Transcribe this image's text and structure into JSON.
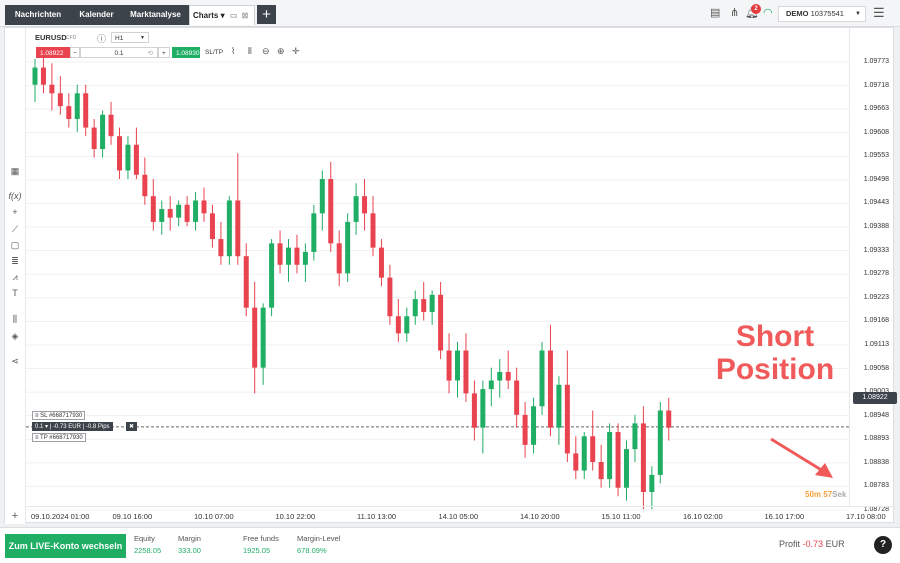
{
  "nav": {
    "tabs": [
      "Nachrichten",
      "Kalender",
      "Marktanalyse",
      "Charts ▾"
    ],
    "add_tab": "+",
    "notification_count": "2",
    "account_type": "DEMO",
    "account_number": "10375541"
  },
  "toolbar": {
    "symbol": "EURUSD",
    "symbol_suffix": "CFD",
    "timeframe": "H1",
    "sell_price": "1.08922",
    "quantity": "0.1",
    "buy_price": "1.08930",
    "sltp": "SL/TP"
  },
  "price_axis": [
    "1.09773",
    "1.09718",
    "1.09663",
    "1.09608",
    "1.09553",
    "1.09498",
    "1.09443",
    "1.09388",
    "1.09333",
    "1.09278",
    "1.09223",
    "1.09168",
    "1.09113",
    "1.09058",
    "1.09003",
    "1.08948",
    "1.08893",
    "1.08838",
    "1.08783",
    "1.08728"
  ],
  "current_price": "1.08922",
  "time_axis": [
    "09.10.2024 01:00",
    "09.10 16:00",
    "10.10 07:00",
    "10.10 22:00",
    "11.10 13:00",
    "14.10 05:00",
    "14.10 20:00",
    "15.10 11:00",
    "16.10 02:00",
    "16.10 17:00",
    "17.10 08:00"
  ],
  "position": {
    "sl_tag": "≡ SL",
    "sl_id": "#668717930",
    "qty": "0.1 ▾",
    "pl": "-0.73 EUR",
    "pips": "-0.8 Pips",
    "close": "✖",
    "tp_tag": "≡ TP",
    "tp_id": "#668717930"
  },
  "annotation": {
    "line1": "Short",
    "line2": "Position"
  },
  "timer": {
    "min": "50m",
    "sec": "57",
    "unit": "Sek"
  },
  "colors": {
    "up": "#1fae64",
    "down": "#e8434f",
    "annotation": "#f05a5a",
    "accent": "#1fae64"
  },
  "chart_data": {
    "type": "candlestick",
    "symbol": "EURUSD",
    "timeframe": "H1",
    "ylim": [
      1.087,
      1.098
    ],
    "candles": [
      [
        1.0972,
        1.0978,
        1.0968,
        1.0976
      ],
      [
        1.0976,
        1.098,
        1.097,
        1.0972
      ],
      [
        1.0972,
        1.0977,
        1.0966,
        1.097
      ],
      [
        1.097,
        1.0974,
        1.0965,
        1.0967
      ],
      [
        1.0967,
        1.097,
        1.0962,
        1.0964
      ],
      [
        1.0964,
        1.0972,
        1.0961,
        1.097
      ],
      [
        1.097,
        1.0972,
        1.096,
        1.0962
      ],
      [
        1.0962,
        1.0964,
        1.0955,
        1.0957
      ],
      [
        1.0957,
        1.0966,
        1.0955,
        1.0965
      ],
      [
        1.0965,
        1.0968,
        1.0958,
        1.096
      ],
      [
        1.096,
        1.0962,
        1.095,
        1.0952
      ],
      [
        1.0952,
        1.096,
        1.095,
        1.0958
      ],
      [
        1.0958,
        1.0962,
        1.095,
        1.0951
      ],
      [
        1.0951,
        1.0955,
        1.0944,
        1.0946
      ],
      [
        1.0946,
        1.095,
        1.0938,
        1.094
      ],
      [
        1.094,
        1.0945,
        1.0937,
        1.0943
      ],
      [
        1.0943,
        1.0946,
        1.0938,
        1.0941
      ],
      [
        1.0941,
        1.0945,
        1.0939,
        1.0944
      ],
      [
        1.0944,
        1.0946,
        1.0939,
        1.094
      ],
      [
        1.094,
        1.0947,
        1.0938,
        1.0945
      ],
      [
        1.0945,
        1.0948,
        1.094,
        1.0942
      ],
      [
        1.0942,
        1.0944,
        1.0934,
        1.0936
      ],
      [
        1.0936,
        1.094,
        1.093,
        1.0932
      ],
      [
        1.0932,
        1.0946,
        1.093,
        1.0945
      ],
      [
        1.0945,
        1.0956,
        1.093,
        1.0932
      ],
      [
        1.0932,
        1.0935,
        1.0918,
        1.092
      ],
      [
        1.092,
        1.0926,
        1.09,
        1.0906
      ],
      [
        1.0906,
        1.0921,
        1.0902,
        1.092
      ],
      [
        1.092,
        1.0936,
        1.0918,
        1.0935
      ],
      [
        1.0935,
        1.0938,
        1.0928,
        1.093
      ],
      [
        1.093,
        1.0936,
        1.0926,
        1.0934
      ],
      [
        1.0934,
        1.0937,
        1.0928,
        1.093
      ],
      [
        1.093,
        1.0935,
        1.0926,
        1.0933
      ],
      [
        1.0933,
        1.0944,
        1.0931,
        1.0942
      ],
      [
        1.0942,
        1.0952,
        1.0938,
        1.095
      ],
      [
        1.095,
        1.0954,
        1.0933,
        1.0935
      ],
      [
        1.0935,
        1.0938,
        1.0925,
        1.0928
      ],
      [
        1.0928,
        1.0942,
        1.0926,
        1.094
      ],
      [
        1.094,
        1.0949,
        1.0937,
        1.0946
      ],
      [
        1.0946,
        1.095,
        1.0938,
        1.0942
      ],
      [
        1.0942,
        1.0946,
        1.0932,
        1.0934
      ],
      [
        1.0934,
        1.0936,
        1.0925,
        1.0927
      ],
      [
        1.0927,
        1.093,
        1.0916,
        1.0918
      ],
      [
        1.0918,
        1.0922,
        1.0912,
        1.0914
      ],
      [
        1.0914,
        1.092,
        1.0912,
        1.0918
      ],
      [
        1.0918,
        1.0924,
        1.0916,
        1.0922
      ],
      [
        1.0922,
        1.0926,
        1.0917,
        1.0919
      ],
      [
        1.0919,
        1.0924,
        1.0916,
        1.0923
      ],
      [
        1.0923,
        1.0926,
        1.0908,
        1.091
      ],
      [
        1.091,
        1.0914,
        1.09,
        1.0903
      ],
      [
        1.0903,
        1.0912,
        1.0899,
        1.091
      ],
      [
        1.091,
        1.0914,
        1.0898,
        1.09
      ],
      [
        1.09,
        1.0903,
        1.0889,
        1.0892
      ],
      [
        1.0892,
        1.0903,
        1.0886,
        1.0901
      ],
      [
        1.0901,
        1.0906,
        1.0897,
        1.0903
      ],
      [
        1.0903,
        1.0908,
        1.0899,
        1.0905
      ],
      [
        1.0905,
        1.091,
        1.0901,
        1.0903
      ],
      [
        1.0903,
        1.0906,
        1.0892,
        1.0895
      ],
      [
        1.0895,
        1.0898,
        1.0885,
        1.0888
      ],
      [
        1.0888,
        1.0899,
        1.0886,
        1.0897
      ],
      [
        1.0897,
        1.0912,
        1.0895,
        1.091
      ],
      [
        1.091,
        1.0916,
        1.089,
        1.0892
      ],
      [
        1.0892,
        1.0904,
        1.0888,
        1.0902
      ],
      [
        1.0902,
        1.091,
        1.0884,
        1.0886
      ],
      [
        1.0886,
        1.089,
        1.088,
        1.0882
      ],
      [
        1.0882,
        1.0891,
        1.088,
        1.089
      ],
      [
        1.089,
        1.0896,
        1.0882,
        1.0884
      ],
      [
        1.0884,
        1.0888,
        1.0878,
        1.088
      ],
      [
        1.088,
        1.0893,
        1.0878,
        1.0891
      ],
      [
        1.0891,
        1.0893,
        1.0876,
        1.0878
      ],
      [
        1.0878,
        1.0889,
        1.0875,
        1.0887
      ],
      [
        1.0887,
        1.0895,
        1.0884,
        1.0893
      ],
      [
        1.0893,
        1.0897,
        1.0873,
        1.0877
      ],
      [
        1.0877,
        1.0883,
        1.0873,
        1.0881
      ],
      [
        1.0881,
        1.0898,
        1.0879,
        1.0896
      ],
      [
        1.0896,
        1.0899,
        1.0889,
        1.0892
      ]
    ]
  },
  "bottom": {
    "live_button": "Zum LIVE-Konto wechseln",
    "equity_label": "Equity",
    "equity_value": "2258.05",
    "margin_label": "Margin",
    "margin_value": "333.00",
    "free_label": "Free funds",
    "free_value": "1925.05",
    "level_label": "Margin-Level",
    "level_value": "678.09%",
    "profit_label": "Profit",
    "profit_value": "-0.73",
    "profit_currency": "EUR",
    "help": "?"
  }
}
